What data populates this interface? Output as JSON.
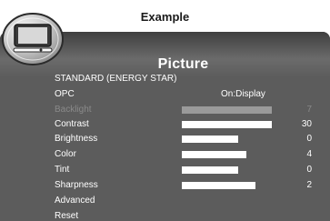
{
  "caption": "Example",
  "menu": {
    "title": "Picture",
    "mode": "STANDARD (ENERGY STAR)",
    "opc": {
      "label": "OPC",
      "value": "On:Display"
    },
    "rows": [
      {
        "label": "Backlight",
        "value": "7",
        "level": 1.0,
        "enabled": false
      },
      {
        "label": "Contrast",
        "value": "30",
        "level": 1.0,
        "enabled": true
      },
      {
        "label": "Brightness",
        "value": "0",
        "level": 0.63,
        "enabled": true
      },
      {
        "label": "Color",
        "value": "4",
        "level": 0.72,
        "enabled": true
      },
      {
        "label": "Tint",
        "value": "0",
        "level": 0.63,
        "enabled": true
      },
      {
        "label": "Sharpness",
        "value": "2",
        "level": 0.82,
        "enabled": true
      }
    ],
    "advanced_label": "Advanced",
    "reset_label": "Reset"
  },
  "colors": {
    "panel": "#5c5c5c",
    "text": "#ffffff",
    "disabled_text": "#8a8a8a",
    "bar": "#ffffff",
    "disabled_bar": "#9a9a9a"
  },
  "icons": {
    "badge": "tv-icon"
  }
}
